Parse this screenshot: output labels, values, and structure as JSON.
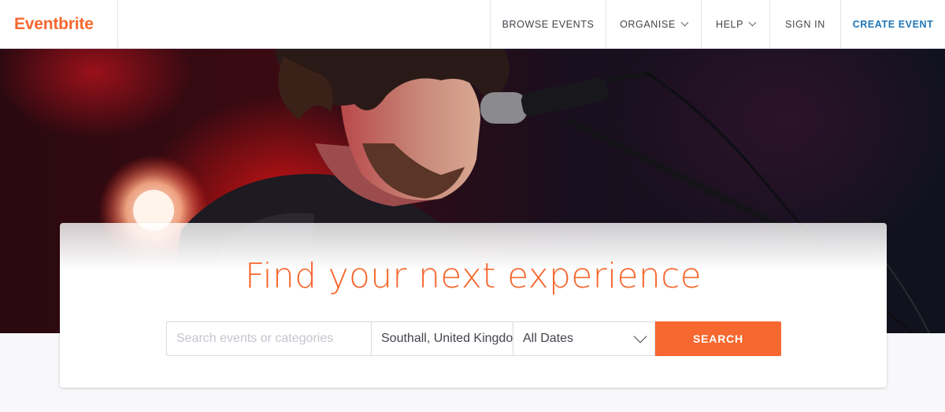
{
  "header": {
    "logo": "Eventbrite",
    "nav": {
      "browse": "BROWSE EVENTS",
      "organise": "ORGANISE",
      "help": "HELP",
      "signin": "SIGN IN",
      "create": "CREATE EVENT"
    }
  },
  "hero": {
    "headline": "Find your next experience"
  },
  "search": {
    "query_placeholder": "Search events or categories",
    "query_value": "",
    "location_value": "Southall, United Kingdom",
    "dates_selected": "All Dates",
    "button_label": "SEARCH"
  },
  "colors": {
    "brand_orange": "#f6682f",
    "link_blue": "#1f76b8",
    "text_dark": "#45434d",
    "page_bg": "#f8f7fa"
  },
  "icons": {
    "dropdown": "chevron-down-icon"
  }
}
